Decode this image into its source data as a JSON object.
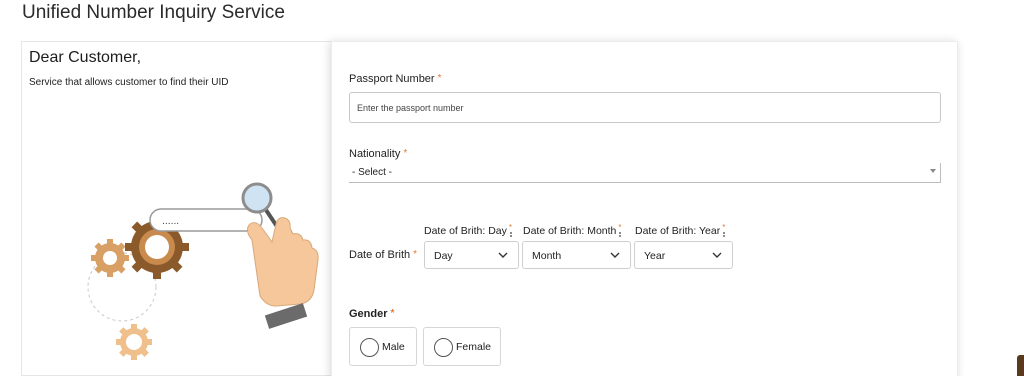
{
  "page": {
    "title": "Unified Number Inquiry Service"
  },
  "intro": {
    "greeting": "Dear Customer,",
    "description": "Service that allows customer to find their UID",
    "search_bar_text": "......"
  },
  "form": {
    "required_mark": "*",
    "passport": {
      "label": "Passport Number",
      "placeholder": "Enter the passport number",
      "value": ""
    },
    "nationality": {
      "label": "Nationality",
      "value": "- Select -"
    },
    "dob": {
      "label": "Date of Brith",
      "day": {
        "label": "Date of Brith: Day",
        "value": "Day"
      },
      "month": {
        "label": "Date of Brith: Month",
        "value": "Month"
      },
      "year": {
        "label": "Date of Brith: Year",
        "value": "Year"
      }
    },
    "gender": {
      "label": "Gender",
      "options": [
        "Male",
        "Female"
      ]
    }
  },
  "colors": {
    "required": "#e07b39",
    "gear_brown": "#8a5a2b",
    "gear_orange": "#e0a060",
    "hand": "#f6c79a"
  }
}
